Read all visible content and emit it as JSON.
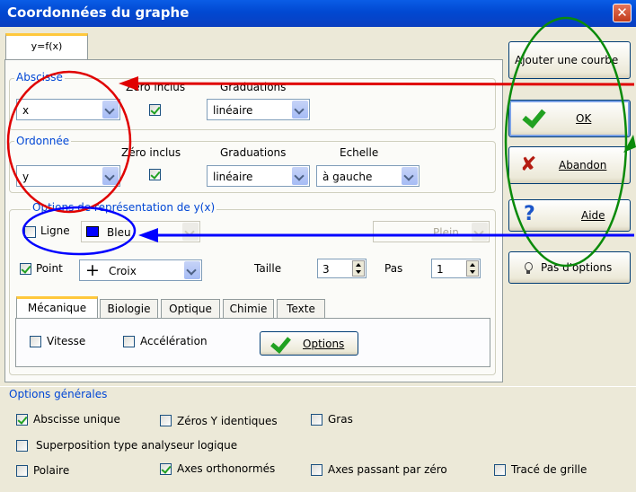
{
  "window": {
    "title": "Coordonnées du graphe",
    "close_label": "✕"
  },
  "tabs": {
    "main": "y=f(x)"
  },
  "abscisse": {
    "legend": "Abscisse",
    "value": "x",
    "zero_label": "Zéro inclus",
    "zero_checked": true,
    "grad_label": "Graduations",
    "grad_value": "linéaire"
  },
  "ordonnee": {
    "legend": "Ordonnée",
    "value": "y",
    "zero_label": "Zéro inclus",
    "zero_checked": true,
    "grad_label": "Graduations",
    "grad_value": "linéaire",
    "echelle_label": "Echelle",
    "echelle_value": "à gauche"
  },
  "options_yx": {
    "legend": "Options de représentation de y(x)",
    "ligne_label": "Ligne",
    "ligne_checked": false,
    "ligne_color": "Bleu",
    "ligne_color_hex": "#0000ff",
    "ligne_style": "Plein",
    "point_label": "Point",
    "point_checked": true,
    "point_glyph": "+",
    "point_value": "Croix",
    "taille_label": "Taille",
    "taille_value": "3",
    "pas_label": "Pas",
    "pas_value": "1"
  },
  "subtabs": [
    "Mécanique",
    "Biologie",
    "Optique",
    "Chimie",
    "Texte"
  ],
  "mecanique": {
    "vitesse": "Vitesse",
    "acceleration": "Accélération",
    "options_button": "Options"
  },
  "options_generales": {
    "legend": "Options générales",
    "abscisse_unique": "Abscisse unique",
    "zeros_y": "Zéros Y identiques",
    "gras": "Gras",
    "superposition": "Superposition type analyseur logique",
    "polaire": "Polaire",
    "axes_ortho": "Axes orthonormés",
    "axes_zero": "Axes passant par zéro",
    "trace_grille": "Tracé de grille"
  },
  "buttons": {
    "ajouter": "Ajouter une courbe",
    "ok": "OK",
    "abandon": "Abandon",
    "aide": "Aide",
    "pas_options": "Pas d'options"
  },
  "colors": {
    "annotation_red": "#e00000",
    "annotation_green": "#0a8a0a",
    "annotation_blue": "#0000ff",
    "group_label": "#0046d5"
  }
}
